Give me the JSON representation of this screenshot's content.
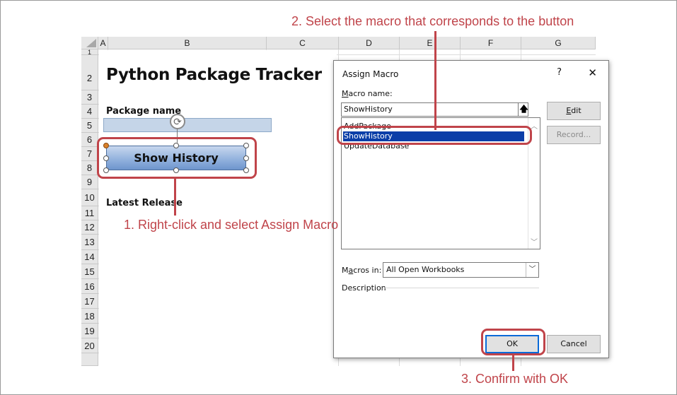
{
  "callouts": {
    "step1": "1. Right-click and select Assign Macro",
    "step2": "2. Select the macro that corresponds to the button",
    "step3": "3. Confirm with OK",
    "color": "#c0444a"
  },
  "sheet": {
    "columns": [
      "A",
      "B",
      "C",
      "D",
      "E",
      "F",
      "G"
    ],
    "rows": [
      "1",
      "2",
      "3",
      "4",
      "5",
      "6",
      "7",
      "8",
      "9",
      "10",
      "11",
      "12",
      "13",
      "14",
      "15",
      "16",
      "17",
      "18",
      "19",
      "20"
    ],
    "title": "Python Package Tracker",
    "package_label": "Package name",
    "latest_label": "Latest Release",
    "button_label": "Show History",
    "button_color": "#8fb0dc",
    "input_color": "#c5d5e8"
  },
  "dialog": {
    "title": "Assign Macro",
    "help": "?",
    "close": "✕",
    "macro_name_label_key": "M",
    "macro_name_label_rest": "acro name:",
    "macro_name_value": "ShowHistory",
    "macros": [
      "AddPackage",
      "ShowHistory",
      "UpdateDatabase"
    ],
    "selected_macro": "ShowHistory",
    "edit_key": "E",
    "edit_rest": "dit",
    "record_label": "Record...",
    "macros_in_label_pre": "M",
    "macros_in_label_key": "a",
    "macros_in_label_rest": "cros in:",
    "macros_in_value": "All Open Workbooks",
    "description_label": "Description",
    "ok_label": "OK",
    "cancel_label": "Cancel",
    "selection_color": "#0b3ea8"
  }
}
